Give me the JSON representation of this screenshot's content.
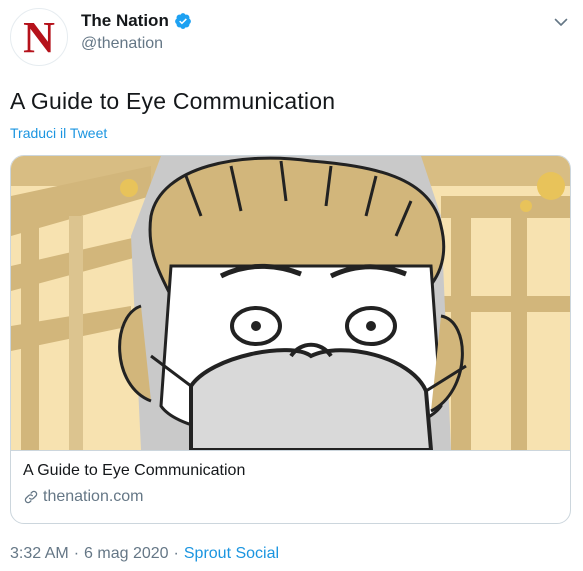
{
  "account": {
    "display_name": "The Nation",
    "handle": "@thenation",
    "avatar_letter": "N",
    "verified": true
  },
  "tweet": {
    "text": "A Guide to Eye Communication",
    "translate_label": "Traduci il Tweet"
  },
  "card": {
    "title": "A Guide to Eye Communication",
    "domain": "thenation.com",
    "image_icon": "masked-man-illustration"
  },
  "footer": {
    "time": "3:32 AM",
    "separator1": "·",
    "date": "6 mag 2020",
    "separator2": "·",
    "source": "Sprout Social"
  },
  "colors": {
    "brand_red": "#b5121b",
    "link_blue": "#1b95e0",
    "muted_gray": "#657786",
    "verified_blue": "#1da1f2"
  }
}
